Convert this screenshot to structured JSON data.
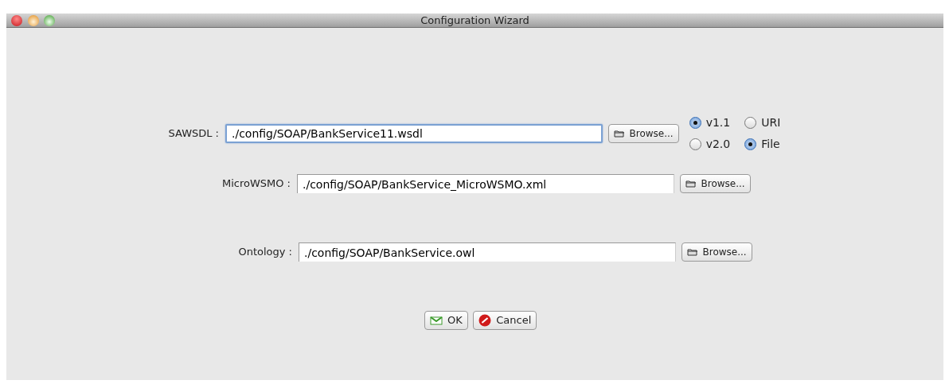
{
  "window": {
    "title": "Configuration Wizard"
  },
  "fields": [
    {
      "label": "SAWSDL :",
      "value": "./config/SOAP/BankService11.wsdl",
      "focused": true,
      "browse": "Browse..."
    },
    {
      "label": "MicroWSMO :",
      "value": "./config/SOAP/BankService_MicroWSMO.xml",
      "focused": false,
      "browse": "Browse..."
    },
    {
      "label": "Ontology :",
      "value": "./config/SOAP/BankService.owl",
      "focused": false,
      "browse": "Browse..."
    }
  ],
  "radios": [
    {
      "label": "v1.1",
      "selected": true
    },
    {
      "label": "URI",
      "selected": false
    },
    {
      "label": "v2.0",
      "selected": false
    },
    {
      "label": "File",
      "selected": true
    }
  ],
  "buttons": [
    {
      "kind": "ok",
      "label": "OK"
    },
    {
      "kind": "cancel",
      "label": "Cancel"
    }
  ]
}
